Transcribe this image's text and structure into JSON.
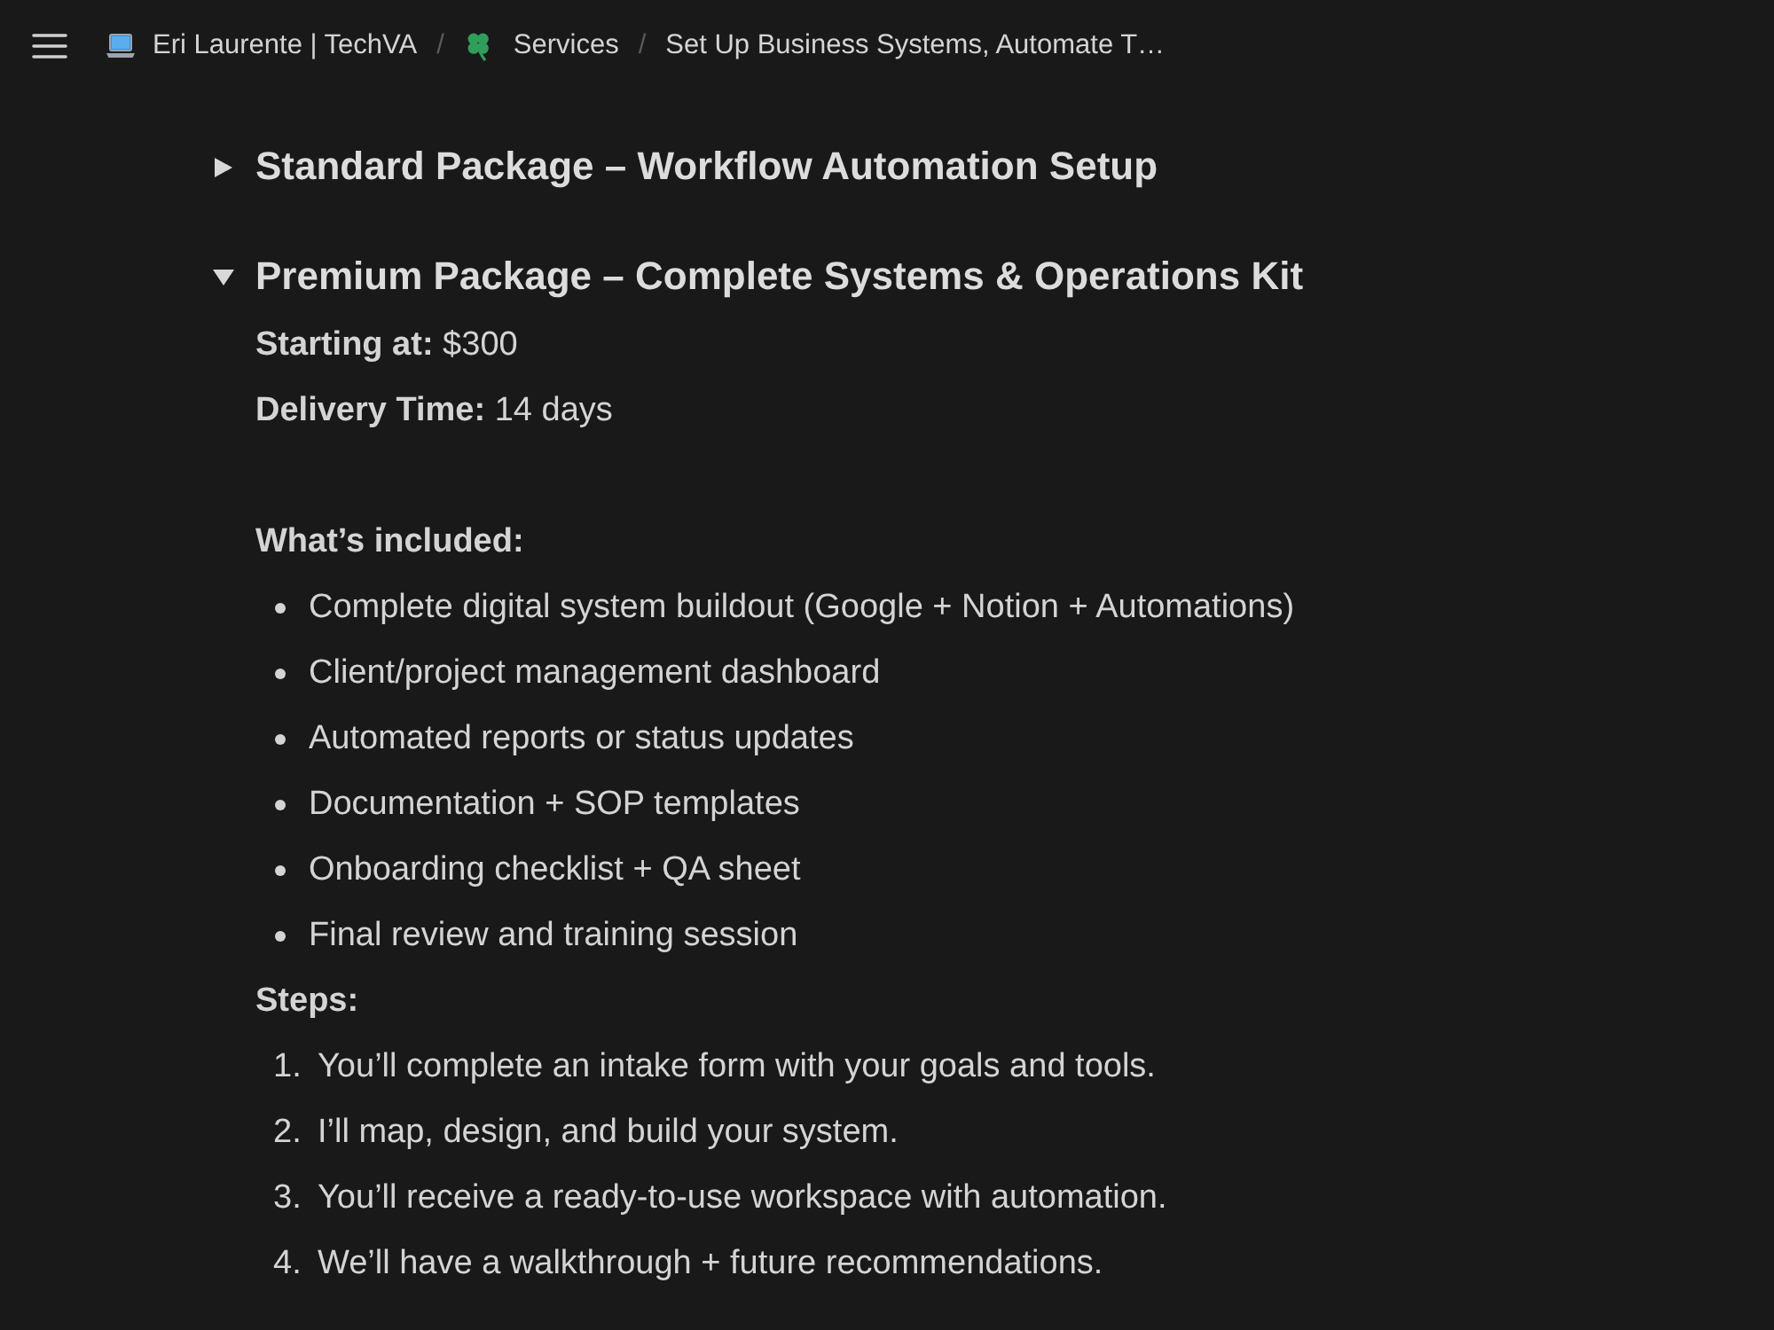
{
  "topbar": {
    "breadcrumbs": [
      {
        "kind": "workspace",
        "label": "Eri Laurente | TechVA"
      },
      {
        "kind": "page",
        "label": "Services"
      },
      {
        "kind": "current",
        "label": "Set Up Business Systems, Automate T…"
      }
    ],
    "separator": "/"
  },
  "toggles": [
    {
      "title": "Standard Package – Workflow Automation Setup",
      "expanded": false
    },
    {
      "title": "Premium Package – Complete Systems & Operations Kit",
      "expanded": true,
      "blocks": [
        {
          "kind": "paragraph",
          "text": "**Starting at:** $300"
        },
        {
          "kind": "paragraph",
          "text": "**Delivery Time:** 14 days"
        },
        {
          "kind": "blank"
        },
        {
          "kind": "label",
          "text": "What’s included:"
        },
        {
          "kind": "bullets",
          "items": [
            "Complete digital system buildout (Google + Notion + Automations)",
            "Client/project management dashboard",
            "Automated reports or status updates",
            "Documentation + SOP templates",
            "Onboarding checklist + QA sheet",
            "Final review and training session"
          ]
        },
        {
          "kind": "label",
          "text": "Steps:"
        },
        {
          "kind": "numbered",
          "items": [
            {
              "number": "1.",
              "text": "You’ll complete an intake form with your goals and tools."
            },
            {
              "number": "2.",
              "text": "I’ll map, design, and build your system."
            },
            {
              "number": "3.",
              "text": "You’ll receive a ready-to-use workspace with automation."
            },
            {
              "number": "4.",
              "text": "We’ll have a walkthrough + future recommendations."
            }
          ]
        }
      ]
    }
  ]
}
